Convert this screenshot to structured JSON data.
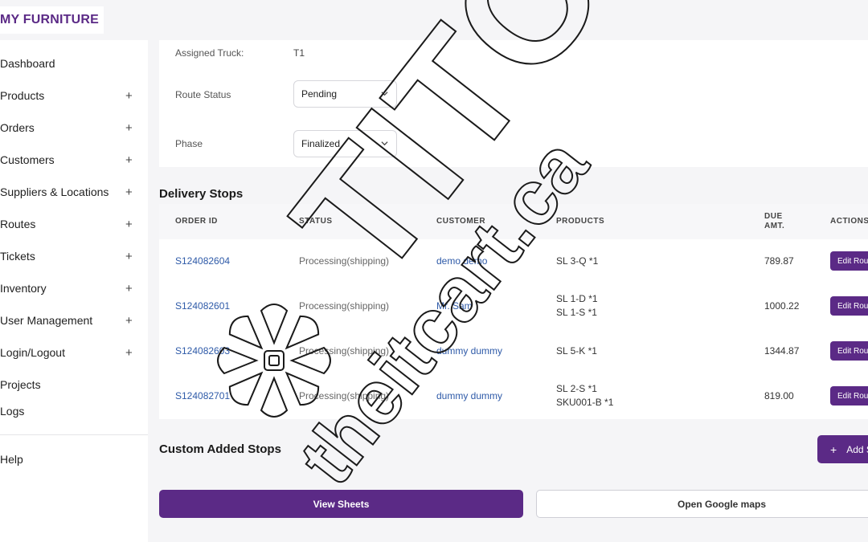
{
  "brand": "MY FURNITURE",
  "colors": {
    "accent": "#5b2a86",
    "link": "#2e5aa8"
  },
  "sidebar": {
    "items": [
      {
        "label": "Dashboard",
        "expandable": false
      },
      {
        "label": "Products",
        "expandable": true
      },
      {
        "label": "Orders",
        "expandable": true
      },
      {
        "label": "Customers",
        "expandable": true
      },
      {
        "label": "Suppliers & Locations",
        "expandable": true
      },
      {
        "label": "Routes",
        "expandable": true
      },
      {
        "label": "Tickets",
        "expandable": true
      },
      {
        "label": "Inventory",
        "expandable": true
      },
      {
        "label": "User Management",
        "expandable": true
      },
      {
        "label": "Login/Logout",
        "expandable": true
      },
      {
        "label": "Projects",
        "expandable": false
      },
      {
        "label": "Logs",
        "expandable": false
      },
      {
        "label": "Help",
        "expandable": false
      }
    ],
    "expand_symbol": "+"
  },
  "route": {
    "assigned_truck_label": "Assigned Truck:",
    "assigned_truck_value": "T1",
    "route_status_label": "Route Status",
    "route_status_value": "Pending",
    "phase_label": "Phase",
    "phase_value": "Finalized"
  },
  "delivery_stops": {
    "title": "Delivery Stops",
    "columns": [
      "ORDER ID",
      "STATUS",
      "CUSTOMER",
      "PRODUCTS",
      "DUE AMT.",
      "ACTIONS"
    ],
    "rows": [
      {
        "order_id": "S124082604",
        "status": "Processing(shipping)",
        "customer": "demo demo",
        "products": [
          "SL 3-Q *1"
        ],
        "due": "789.87",
        "action": "Edit Route"
      },
      {
        "order_id": "S124082601",
        "status": "Processing(shipping)",
        "customer": "Mr. Sam",
        "products": [
          "SL 1-D *1",
          "SL 1-S *1"
        ],
        "due": "1000.22",
        "action": "Edit Route"
      },
      {
        "order_id": "S124082603",
        "status": "Processing(shipping)",
        "customer": "dummy dummy",
        "products": [
          "SL 5-K *1"
        ],
        "due": "1344.87",
        "action": "Edit Route"
      },
      {
        "order_id": "S124082701",
        "status": "Processing(shipping)",
        "customer": "dummy dummy",
        "products": [
          "SL 2-S *1",
          "SKU001-B *1"
        ],
        "due": "819.00",
        "action": "Edit Route"
      }
    ]
  },
  "custom_stops": {
    "title": "Custom Added Stops",
    "add_label": "Add Stop",
    "add_symbol": "+"
  },
  "footer_buttons": {
    "view_sheets": "View Sheets",
    "open_maps": "Open Google maps"
  },
  "watermark": {
    "text_large": "TITC",
    "text_small": "theitcart.ca"
  }
}
